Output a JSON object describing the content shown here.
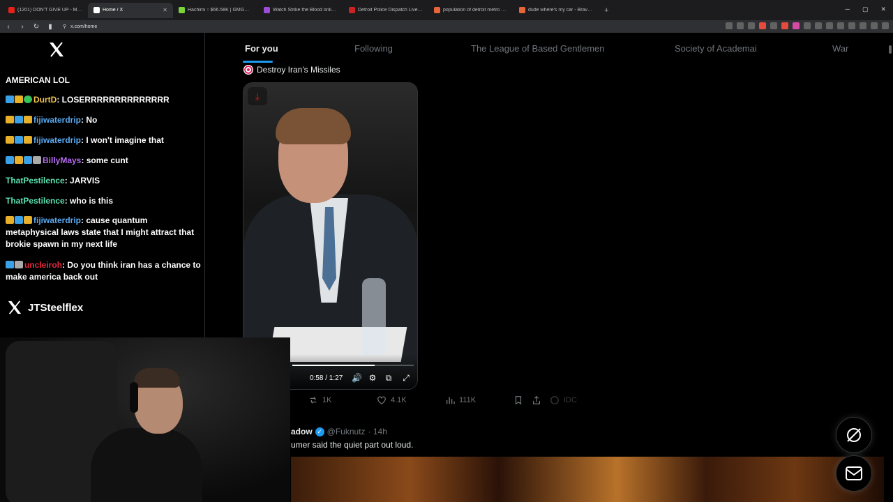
{
  "browser": {
    "tabs": [
      {
        "label": "(1201) DON'T GIVE UP - Motivatio...",
        "color": "#e62117"
      },
      {
        "label": "Home / X",
        "color": "#ffffff",
        "active": true
      },
      {
        "label": "Hachimi ↑ $66.58K | GMGN.AI Fast Tr...",
        "color": "#7bd33a"
      },
      {
        "label": "Watch Strike the Blood online free o...",
        "color": "#9b4dd6"
      },
      {
        "label": "Detroit Police Dispatch Live Audio Fe...",
        "color": "#cc2222"
      },
      {
        "label": "population of detroit metro area - B...",
        "color": "#e8643a"
      },
      {
        "label": "dude where's my car - Brave Search",
        "color": "#e8643a"
      }
    ],
    "new_tab": "+",
    "url": "x.com/home"
  },
  "chat": {
    "title": "AMERICAN LOL",
    "messages": [
      {
        "user": "DurtD",
        "text": ": LOSERRRRRRRRRRRRRR",
        "color": "yel",
        "badges": [
          "b-blue",
          "b-yel",
          "b-grn"
        ]
      },
      {
        "user": "fijiwaterdrip",
        "text": ": No",
        "color": "blue",
        "badges": [
          "b-yel",
          "b-blue",
          "b-yel"
        ]
      },
      {
        "user": "fijiwaterdrip",
        "text": ": I won't imagine that",
        "color": "blue",
        "badges": [
          "b-yel",
          "b-blue",
          "b-yel"
        ]
      },
      {
        "user": "BillyMays",
        "text": ": some cunt",
        "color": "purp",
        "badges": [
          "b-blue",
          "b-yel",
          "b-blue",
          "b-gry"
        ]
      },
      {
        "user": "ThatPestilence",
        "text": ": JARVIS",
        "color": "teal",
        "badges": []
      },
      {
        "user": "ThatPestilence",
        "text": ": who is this",
        "color": "teal",
        "badges": []
      },
      {
        "user": "fijiwaterdrip",
        "text": ": cause quantum metaphysical laws state that I might attract that brokie spawn in my next life",
        "color": "blue",
        "badges": [
          "b-yel",
          "b-blue",
          "b-yel"
        ]
      },
      {
        "user": "uncleiroh",
        "text": ": Do you think iran has a chance to make america back out",
        "color": "red",
        "badges": [
          "b-blue",
          "b-gry"
        ]
      }
    ],
    "channel_user": "JTSteelflex"
  },
  "feed": {
    "tabs": [
      "For you",
      "Following",
      "The League of Based Gentlemen",
      "Society of Academai",
      "War"
    ],
    "tweet1": {
      "text": "Destroy Iran's Missiles",
      "video": {
        "time": "0:58 / 1:27",
        "progress": 0.68
      },
      "actions": {
        "retweets": "1K",
        "likes": "4.1K",
        "views": "111K",
        "grok": "IDC"
      }
    },
    "tweet2": {
      "name": "adow",
      "handle": "@Fuknutz",
      "time": "· 14h",
      "text": "umer said the quiet part out loud."
    }
  },
  "colors": {
    "accent": "#1d9bf0",
    "background": "#000000"
  }
}
